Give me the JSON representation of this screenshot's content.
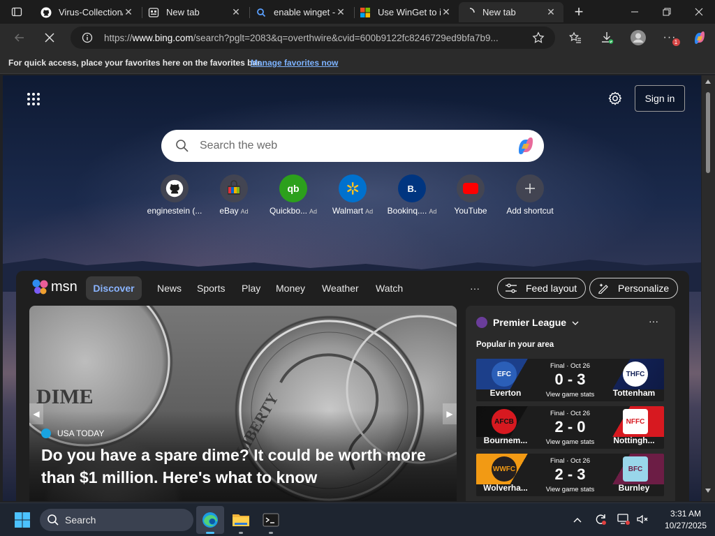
{
  "tabs": [
    {
      "title": "Virus-Collection/"
    },
    {
      "title": "New tab"
    },
    {
      "title": "enable winget - S"
    },
    {
      "title": "Use WinGet to in"
    },
    {
      "title": "New tab"
    }
  ],
  "address": {
    "prefix": "https://",
    "host": "www.bing.com",
    "path": "/search?pglt=2083&q=overthwire&cvid=600b9122fc8246729ed9bfa7b9..."
  },
  "favorites_bar": {
    "message": "For quick access, place your favorites here on the favorites bar.",
    "link": "Manage favorites now"
  },
  "header": {
    "sign_in": "Sign in"
  },
  "search": {
    "placeholder": "Search the web"
  },
  "quick_links": [
    {
      "label": "enginestein (...",
      "ad": ""
    },
    {
      "label": "eBay",
      "ad": "Ad"
    },
    {
      "label": "Quickbo...",
      "ad": "Ad"
    },
    {
      "label": "Walmart",
      "ad": "Ad"
    },
    {
      "label": "Bookinq....",
      "ad": "Ad"
    },
    {
      "label": "YouTube",
      "ad": ""
    },
    {
      "label": "Add shortcut",
      "ad": ""
    }
  ],
  "feed": {
    "brand": "msn",
    "nav": [
      "Discover",
      "News",
      "Sports",
      "Play",
      "Money",
      "Weather",
      "Watch"
    ],
    "more": "···",
    "feed_layout": "Feed layout",
    "personalize": "Personalize"
  },
  "hero": {
    "source": "USA TODAY",
    "headline": "Do you have a spare dime? It could be worth more than $1 million. Here's what to know"
  },
  "premier_league": {
    "title": "Premier League",
    "subtitle": "Popular in your area",
    "more": "···",
    "matches": [
      {
        "status": "Final · Oct 26",
        "score": "0 - 3",
        "home": "Everton",
        "away": "Tottenham",
        "stats": "View game stats"
      },
      {
        "status": "Final · Oct 26",
        "score": "2 - 0",
        "home": "Bournem...",
        "away": "Nottingh...",
        "stats": "View game stats"
      },
      {
        "status": "Final · Oct 26",
        "score": "2 - 3",
        "home": "Wolverha...",
        "away": "Burnley",
        "stats": "View game stats"
      }
    ]
  },
  "taskbar": {
    "search": "Search",
    "time": "3:31 AM",
    "date": "10/27/2025"
  }
}
